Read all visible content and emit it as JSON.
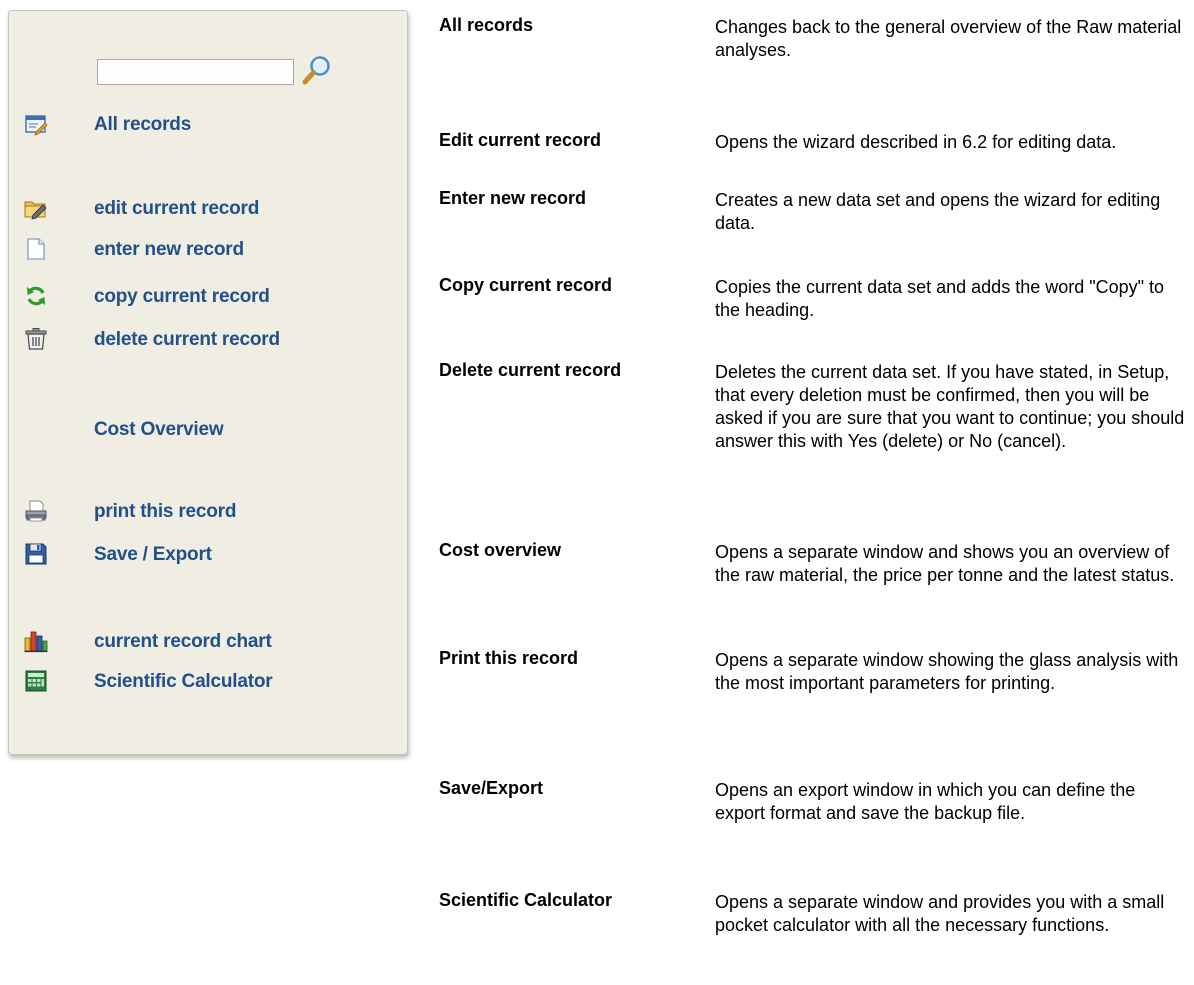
{
  "sidebar": {
    "search": {
      "value": "",
      "icon": "magnifier-icon"
    },
    "items": [
      {
        "label": "All records",
        "icon": "overview-icon"
      },
      {
        "label": "edit current record",
        "icon": "edit-folder-icon"
      },
      {
        "label": "enter new record",
        "icon": "new-document-icon"
      },
      {
        "label": "copy current record",
        "icon": "refresh-icon"
      },
      {
        "label": "delete current record",
        "icon": "trash-icon"
      },
      {
        "label": "Cost Overview",
        "icon": ""
      },
      {
        "label": "print this record",
        "icon": "printer-icon"
      },
      {
        "label": "Save / Export",
        "icon": "floppy-disk-icon"
      },
      {
        "label": "current record chart",
        "icon": "bar-chart-icon"
      },
      {
        "label": "Scientific Calculator",
        "icon": "calculator-icon"
      }
    ],
    "colors": {
      "panel": "#f0ede2",
      "link": "#22508a"
    }
  },
  "definitions": [
    {
      "term": "All records",
      "description": "Changes back to the general overview of the Raw material analyses."
    },
    {
      "term": "Edit current record",
      "description": "Opens the wizard described in 6.2 for editing data."
    },
    {
      "term": "Enter new record",
      "description": "Creates a new data set and opens the wizard for editing data."
    },
    {
      "term": "Copy current record",
      "description": "Copies the current data set and adds the word \"Copy\" to the heading."
    },
    {
      "term": "Delete current record",
      "description": "Deletes the current data set. If you have stated, in Setup, that every deletion must be confirmed, then you will be asked if you are sure that you want to continue; you should answer this with Yes (delete) or No (cancel)."
    },
    {
      "term": "Cost overview",
      "description": "Opens a separate window and shows you an overview of the raw material, the price per tonne and the latest status."
    },
    {
      "term": "Print this record",
      "description": "Opens a separate window showing the glass analysis with the most important parameters for printing."
    },
    {
      "term": "Save/Export",
      "description": "Opens an export window in which you can define the export format and save the backup file."
    },
    {
      "term": "Scientific Calculator",
      "description": "Opens a separate window and provides you with a small pocket calculator with all the necessary functions."
    }
  ]
}
